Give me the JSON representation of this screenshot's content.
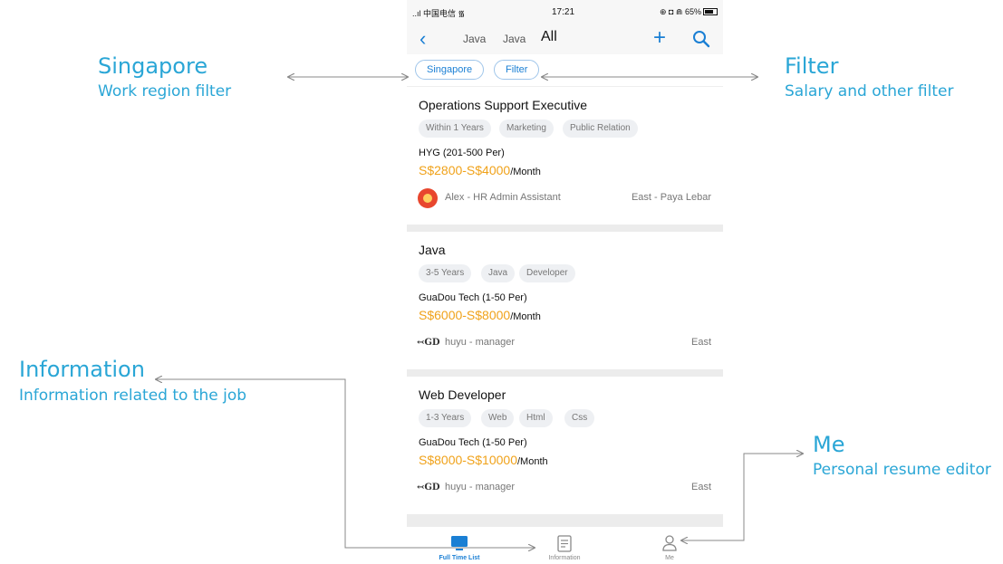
{
  "annotations": {
    "singapore": {
      "title": "Singapore",
      "subtitle": "Work region filter"
    },
    "filter": {
      "title": "Filter",
      "subtitle": "Salary and other filter"
    },
    "information": {
      "title": "Information",
      "subtitle": "Information related to the job"
    },
    "me": {
      "title": "Me",
      "subtitle": "Personal resume editor"
    }
  },
  "statusbar": {
    "carrier": "..ıl 中国电信 ",
    "time": "17:21",
    "indicators": "⊕ ◘ ⋒ 65%"
  },
  "nav": {
    "tabs": [
      "Java",
      "Java",
      "All"
    ],
    "active_tab": "All"
  },
  "filters": [
    "Singapore",
    "Filter"
  ],
  "jobs": [
    {
      "title": "Operations Support Executive",
      "tags": [
        "Within 1 Years",
        "Marketing",
        "Public Relation"
      ],
      "company": "HYG (201-500 Per)",
      "salary": "S$2800-S$4000",
      "period": "/Month",
      "recruiter": "Alex - HR Admin Assistant",
      "location": "East - Paya Lebar",
      "avatar": "avatar-icon"
    },
    {
      "title": "Java",
      "tags": [
        "3-5 Years",
        "Java",
        "Developer"
      ],
      "company": "GuaDou Tech (1-50 Per)",
      "salary": "S$6000-S$8000",
      "period": "/Month",
      "recruiter": "huyu - manager",
      "location": "East",
      "logo_text": "GD"
    },
    {
      "title": "Web Developer",
      "tags": [
        "1-3 Years",
        "Web",
        "Html",
        "Css"
      ],
      "company": "GuaDou Tech (1-50 Per)",
      "salary": "S$8000-S$10000",
      "period": "/Month",
      "recruiter": "huyu - manager",
      "location": "East",
      "logo_text": "GD"
    }
  ],
  "tabbar": {
    "items": [
      {
        "label": "Full Time List",
        "icon": "monitor-icon",
        "active": true
      },
      {
        "label": "Information",
        "icon": "clipboard-icon",
        "active": false
      },
      {
        "label": "Me",
        "icon": "person-icon",
        "active": false
      }
    ]
  },
  "colors": {
    "accent": "#1a7fd4",
    "annotation": "#2aa6d6",
    "salary": "#f0a21a",
    "tag_bg": "#eef0f3",
    "separator": "#ececec"
  }
}
